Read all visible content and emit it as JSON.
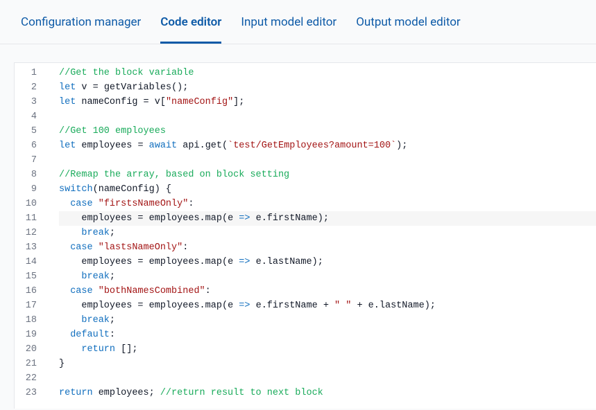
{
  "tabs": [
    {
      "label": "Configuration manager",
      "active": false
    },
    {
      "label": "Code editor",
      "active": true
    },
    {
      "label": "Input model editor",
      "active": false
    },
    {
      "label": "Output model editor",
      "active": false
    }
  ],
  "highlighted_line": 11,
  "code_lines": [
    {
      "n": 1,
      "tokens": [
        {
          "c": "tok-comment",
          "t": "//Get the block variable"
        }
      ]
    },
    {
      "n": 2,
      "tokens": [
        {
          "c": "tok-keyword",
          "t": "let"
        },
        {
          "c": "tok-ident",
          "t": " v "
        },
        {
          "c": "tok-punc",
          "t": "="
        },
        {
          "c": "tok-ident",
          "t": " getVariables"
        },
        {
          "c": "tok-punc",
          "t": "();"
        }
      ]
    },
    {
      "n": 3,
      "tokens": [
        {
          "c": "tok-keyword",
          "t": "let"
        },
        {
          "c": "tok-ident",
          "t": " nameConfig "
        },
        {
          "c": "tok-punc",
          "t": "="
        },
        {
          "c": "tok-ident",
          "t": " v"
        },
        {
          "c": "tok-punc",
          "t": "["
        },
        {
          "c": "tok-string",
          "t": "\"nameConfig\""
        },
        {
          "c": "tok-punc",
          "t": "];"
        }
      ]
    },
    {
      "n": 4,
      "tokens": [
        {
          "c": "tok-ident",
          "t": ""
        }
      ]
    },
    {
      "n": 5,
      "tokens": [
        {
          "c": "tok-comment",
          "t": "//Get 100 employees"
        }
      ]
    },
    {
      "n": 6,
      "tokens": [
        {
          "c": "tok-keyword",
          "t": "let"
        },
        {
          "c": "tok-ident",
          "t": " employees "
        },
        {
          "c": "tok-punc",
          "t": "="
        },
        {
          "c": "tok-ident",
          "t": " "
        },
        {
          "c": "tok-await",
          "t": "await"
        },
        {
          "c": "tok-ident",
          "t": " api"
        },
        {
          "c": "tok-punc",
          "t": "."
        },
        {
          "c": "tok-ident",
          "t": "get"
        },
        {
          "c": "tok-punc",
          "t": "("
        },
        {
          "c": "tok-string",
          "t": "`test/GetEmployees?amount=100`"
        },
        {
          "c": "tok-punc",
          "t": ");"
        }
      ]
    },
    {
      "n": 7,
      "tokens": [
        {
          "c": "tok-ident",
          "t": ""
        }
      ]
    },
    {
      "n": 8,
      "tokens": [
        {
          "c": "tok-comment",
          "t": "//Remap the array, based on block setting"
        }
      ]
    },
    {
      "n": 9,
      "tokens": [
        {
          "c": "tok-kw2",
          "t": "switch"
        },
        {
          "c": "tok-punc",
          "t": "("
        },
        {
          "c": "tok-ident",
          "t": "nameConfig"
        },
        {
          "c": "tok-punc",
          "t": ") {"
        }
      ]
    },
    {
      "n": 10,
      "tokens": [
        {
          "c": "tok-ident",
          "t": "  "
        },
        {
          "c": "tok-kw2",
          "t": "case"
        },
        {
          "c": "tok-ident",
          "t": " "
        },
        {
          "c": "tok-string",
          "t": "\"firstsNameOnly\""
        },
        {
          "c": "tok-punc",
          "t": ":"
        }
      ]
    },
    {
      "n": 11,
      "tokens": [
        {
          "c": "tok-ident",
          "t": "    employees "
        },
        {
          "c": "tok-punc",
          "t": "="
        },
        {
          "c": "tok-ident",
          "t": " employees"
        },
        {
          "c": "tok-punc",
          "t": "."
        },
        {
          "c": "tok-ident",
          "t": "map"
        },
        {
          "c": "tok-punc",
          "t": "("
        },
        {
          "c": "tok-ident",
          "t": "e "
        },
        {
          "c": "tok-kw2",
          "t": "=>"
        },
        {
          "c": "tok-ident",
          "t": " e"
        },
        {
          "c": "tok-punc",
          "t": "."
        },
        {
          "c": "tok-ident",
          "t": "firstName"
        },
        {
          "c": "tok-punc",
          "t": ");"
        }
      ]
    },
    {
      "n": 12,
      "tokens": [
        {
          "c": "tok-ident",
          "t": "    "
        },
        {
          "c": "tok-kw2",
          "t": "break"
        },
        {
          "c": "tok-punc",
          "t": ";"
        }
      ]
    },
    {
      "n": 13,
      "tokens": [
        {
          "c": "tok-ident",
          "t": "  "
        },
        {
          "c": "tok-kw2",
          "t": "case"
        },
        {
          "c": "tok-ident",
          "t": " "
        },
        {
          "c": "tok-string",
          "t": "\"lastsNameOnly\""
        },
        {
          "c": "tok-punc",
          "t": ":"
        }
      ]
    },
    {
      "n": 14,
      "tokens": [
        {
          "c": "tok-ident",
          "t": "    employees "
        },
        {
          "c": "tok-punc",
          "t": "="
        },
        {
          "c": "tok-ident",
          "t": " employees"
        },
        {
          "c": "tok-punc",
          "t": "."
        },
        {
          "c": "tok-ident",
          "t": "map"
        },
        {
          "c": "tok-punc",
          "t": "("
        },
        {
          "c": "tok-ident",
          "t": "e "
        },
        {
          "c": "tok-kw2",
          "t": "=>"
        },
        {
          "c": "tok-ident",
          "t": " e"
        },
        {
          "c": "tok-punc",
          "t": "."
        },
        {
          "c": "tok-ident",
          "t": "lastName"
        },
        {
          "c": "tok-punc",
          "t": ");"
        }
      ]
    },
    {
      "n": 15,
      "tokens": [
        {
          "c": "tok-ident",
          "t": "    "
        },
        {
          "c": "tok-kw2",
          "t": "break"
        },
        {
          "c": "tok-punc",
          "t": ";"
        }
      ]
    },
    {
      "n": 16,
      "tokens": [
        {
          "c": "tok-ident",
          "t": "  "
        },
        {
          "c": "tok-kw2",
          "t": "case"
        },
        {
          "c": "tok-ident",
          "t": " "
        },
        {
          "c": "tok-string",
          "t": "\"bothNamesCombined\""
        },
        {
          "c": "tok-punc",
          "t": ":"
        }
      ]
    },
    {
      "n": 17,
      "tokens": [
        {
          "c": "tok-ident",
          "t": "    employees "
        },
        {
          "c": "tok-punc",
          "t": "="
        },
        {
          "c": "tok-ident",
          "t": " employees"
        },
        {
          "c": "tok-punc",
          "t": "."
        },
        {
          "c": "tok-ident",
          "t": "map"
        },
        {
          "c": "tok-punc",
          "t": "("
        },
        {
          "c": "tok-ident",
          "t": "e "
        },
        {
          "c": "tok-kw2",
          "t": "=>"
        },
        {
          "c": "tok-ident",
          "t": " e"
        },
        {
          "c": "tok-punc",
          "t": "."
        },
        {
          "c": "tok-ident",
          "t": "firstName "
        },
        {
          "c": "tok-punc",
          "t": "+"
        },
        {
          "c": "tok-ident",
          "t": " "
        },
        {
          "c": "tok-string",
          "t": "\" \""
        },
        {
          "c": "tok-ident",
          "t": " "
        },
        {
          "c": "tok-punc",
          "t": "+"
        },
        {
          "c": "tok-ident",
          "t": " e"
        },
        {
          "c": "tok-punc",
          "t": "."
        },
        {
          "c": "tok-ident",
          "t": "lastName"
        },
        {
          "c": "tok-punc",
          "t": ");"
        }
      ]
    },
    {
      "n": 18,
      "tokens": [
        {
          "c": "tok-ident",
          "t": "    "
        },
        {
          "c": "tok-kw2",
          "t": "break"
        },
        {
          "c": "tok-punc",
          "t": ";"
        }
      ]
    },
    {
      "n": 19,
      "tokens": [
        {
          "c": "tok-ident",
          "t": "  "
        },
        {
          "c": "tok-kw2",
          "t": "default"
        },
        {
          "c": "tok-punc",
          "t": ":"
        }
      ]
    },
    {
      "n": 20,
      "tokens": [
        {
          "c": "tok-ident",
          "t": "    "
        },
        {
          "c": "tok-kw2",
          "t": "return"
        },
        {
          "c": "tok-ident",
          "t": " "
        },
        {
          "c": "tok-punc",
          "t": "[];"
        }
      ]
    },
    {
      "n": 21,
      "tokens": [
        {
          "c": "tok-punc",
          "t": "}"
        }
      ]
    },
    {
      "n": 22,
      "tokens": [
        {
          "c": "tok-ident",
          "t": ""
        }
      ]
    },
    {
      "n": 23,
      "tokens": [
        {
          "c": "tok-kw2",
          "t": "return"
        },
        {
          "c": "tok-ident",
          "t": " employees"
        },
        {
          "c": "tok-punc",
          "t": "; "
        },
        {
          "c": "tok-comment",
          "t": "//return result to next block"
        }
      ]
    }
  ]
}
